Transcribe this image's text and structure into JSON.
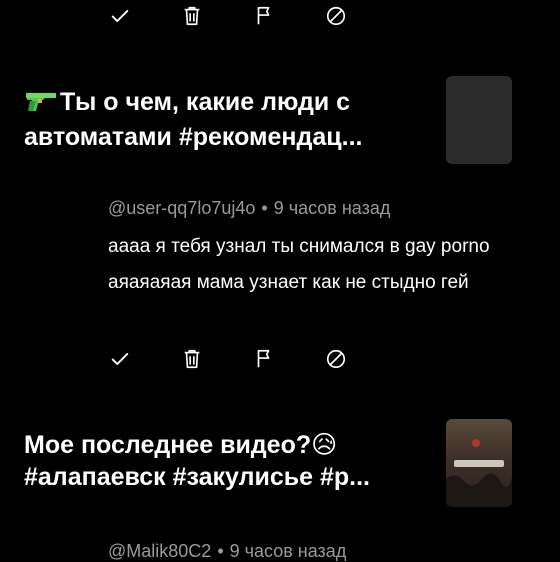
{
  "actions_labels": {
    "approve": "check-icon",
    "delete": "trash-icon",
    "report": "flag-icon",
    "block": "block-icon"
  },
  "videos": [
    {
      "title": "Ты о чем, какие люди с автоматами #рекомендац...",
      "title_emoji": "water-pistol-icon",
      "comment": {
        "author": "@user-qq7lo7uj4o",
        "time": "9 часов назад",
        "text": "аааа я тебя узнал ты снимался в gay porno аяаяаяая мама узнает  как не стыдно гей"
      }
    },
    {
      "title": "Мое последнее видео?😥 #алапаевск #закулисье #р...",
      "comment": {
        "author": "@Malik80C2",
        "time": "9 часов назад"
      }
    }
  ],
  "colors": {
    "background": "#000000",
    "text": "#ffffff",
    "meta": "#9a9a9a",
    "gun": "#4cc94c"
  }
}
